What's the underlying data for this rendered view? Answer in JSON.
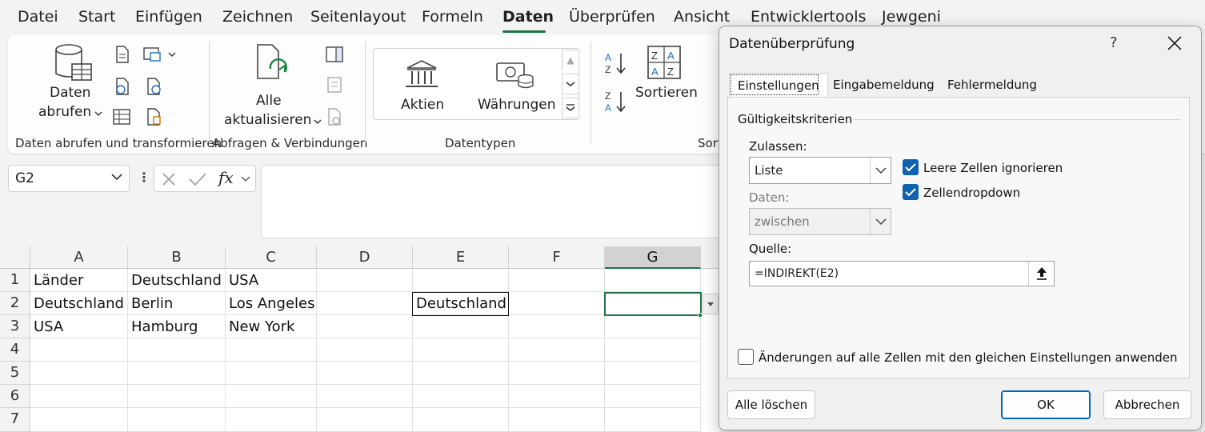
{
  "menu": {
    "items": [
      "Datei",
      "Start",
      "Einfügen",
      "Zeichnen",
      "Seitenlayout",
      "Formeln",
      "Daten",
      "Überprüfen",
      "Ansicht",
      "Entwicklertools",
      "Jewgeni"
    ],
    "active": "Daten"
  },
  "ribbon": {
    "get_data_line1": "Daten",
    "get_data_line2": "abrufen",
    "group1_label": "Daten abrufen und transformieren",
    "refresh_line1": "Alle",
    "refresh_line2": "aktualisieren",
    "group2_label": "Abfragen & Verbindungen",
    "stocks": "Aktien",
    "currencies": "Währungen",
    "group3_label": "Datentypen",
    "sort": "Sortieren",
    "group4_label_partial": "Sort"
  },
  "formula_bar": {
    "name_box": "G2",
    "formula": ""
  },
  "grid": {
    "columns": [
      "A",
      "B",
      "C",
      "D",
      "E",
      "F",
      "G"
    ],
    "selected_column": "G",
    "rows": [
      "1",
      "2",
      "3",
      "4",
      "5",
      "6",
      "7"
    ],
    "cells": [
      [
        "Länder",
        "Deutschland",
        "USA",
        "",
        "",
        "",
        ""
      ],
      [
        "Deutschland",
        "Berlin",
        "Los Angeles",
        "",
        "Deutschland",
        "",
        ""
      ],
      [
        "USA",
        "Hamburg",
        "New York",
        "",
        "",
        "",
        ""
      ],
      [
        "",
        "",
        "",
        "",
        "",
        "",
        ""
      ],
      [
        "",
        "",
        "",
        "",
        "",
        "",
        ""
      ],
      [
        "",
        "",
        "",
        "",
        "",
        "",
        ""
      ],
      [
        "",
        "",
        "",
        "",
        "",
        "",
        ""
      ]
    ],
    "active_cell": "G2"
  },
  "dialog": {
    "title": "Datenüberprüfung",
    "help": "?",
    "tabs": [
      "Einstellungen",
      "Eingabemeldung",
      "Fehlermeldung"
    ],
    "active_tab": "Einstellungen",
    "section_title": "Gültigkeitskriterien",
    "allow_label": "Zulassen:",
    "allow_value": "Liste",
    "data_label": "Daten:",
    "data_value": "zwischen",
    "ignore_blank_label": "Leere Zellen ignorieren",
    "ignore_blank_checked": true,
    "in_cell_dropdown_label": "Zellendropdown",
    "in_cell_dropdown_checked": true,
    "source_label": "Quelle:",
    "source_value": "=INDIREKT(E2)",
    "apply_all_label": "Änderungen auf alle Zellen mit den gleichen Einstellungen anwenden",
    "apply_all_checked": false,
    "clear_all": "Alle löschen",
    "ok": "OK",
    "cancel": "Abbrechen"
  },
  "colors": {
    "accent_green": "#217346",
    "checkbox_blue": "#0f62b0",
    "primary_button_border": "#0067c0"
  }
}
